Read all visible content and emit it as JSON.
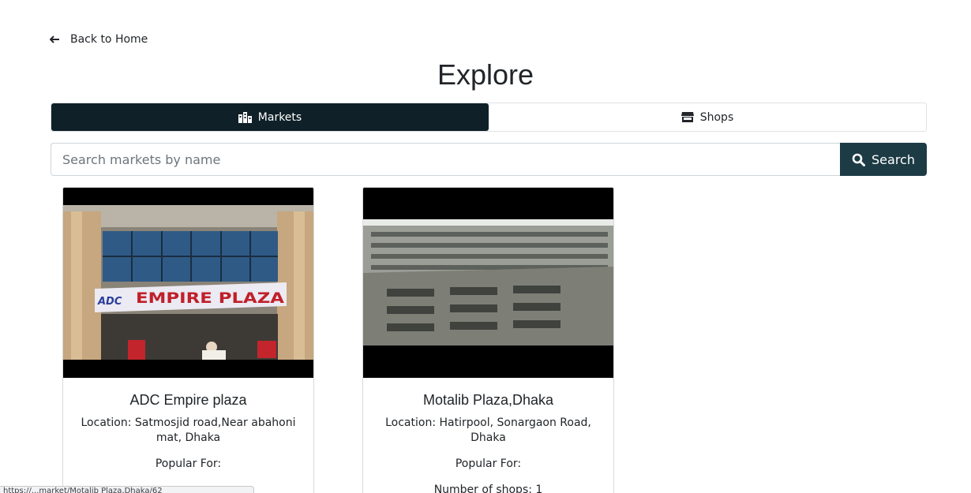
{
  "nav": {
    "back_label": "Back to Home"
  },
  "page": {
    "title": "Explore"
  },
  "tabs": [
    {
      "label": "Markets",
      "icon": "city-icon",
      "active": true
    },
    {
      "label": "Shops",
      "icon": "store-icon",
      "active": false
    }
  ],
  "search": {
    "placeholder": "Search markets by name",
    "value": "",
    "button_label": "Search"
  },
  "markets": [
    {
      "name": "ADC Empire plaza",
      "location": "Location: Satmosjid road,Near abahoni mat, Dhaka",
      "popular_for": "Popular For:",
      "image_sign": "ADC EMPIRE PLAZA"
    },
    {
      "name": "Motalib Plaza,Dhaka",
      "location": "Location: Hatirpool, Sonargaon Road, Dhaka",
      "popular_for": "Popular For:",
      "shops_count": "Number of shops: 1"
    }
  ],
  "status_bar": {
    "url": "https://...market/Motalib Plaza,Dhaka/62"
  },
  "colors": {
    "tab_active_bg": "#0f2028",
    "search_button_bg": "#1d3b45",
    "sign_red": "#c0202a",
    "sign_blue": "#2a3d9a"
  }
}
